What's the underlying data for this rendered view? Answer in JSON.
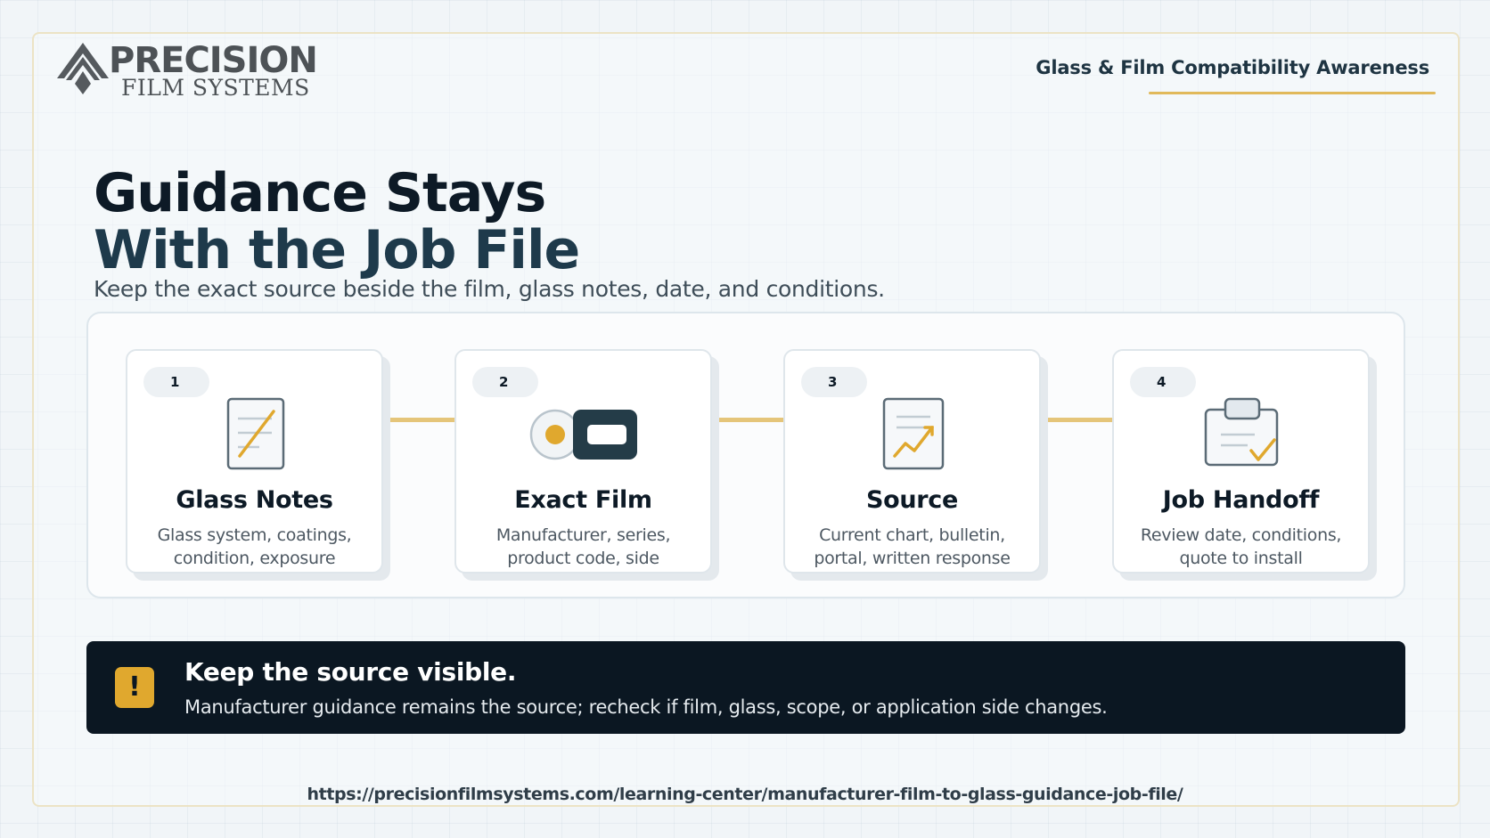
{
  "brand": {
    "logo_main": "PRECISION",
    "logo_sub": "FILM SYSTEMS"
  },
  "header": {
    "tag": "Glass & Film Compatibility Awareness"
  },
  "hero": {
    "title_line1": "Guidance Stays",
    "title_line2": "With the Job File",
    "subtitle": "Keep the exact source beside the film, glass notes, date, and conditions."
  },
  "steps": [
    {
      "number": "1",
      "icon": "document-edit-icon",
      "title": "Glass Notes",
      "desc_line1": "Glass system, coatings,",
      "desc_line2": "condition, exposure"
    },
    {
      "number": "2",
      "icon": "film-roll-icon",
      "title": "Exact Film",
      "desc_line1": "Manufacturer, series,",
      "desc_line2": "product code, side"
    },
    {
      "number": "3",
      "icon": "chart-document-icon",
      "title": "Source",
      "desc_line1": "Current chart, bulletin,",
      "desc_line2": "portal, written response"
    },
    {
      "number": "4",
      "icon": "clipboard-check-icon",
      "title": "Job Handoff",
      "desc_line1": "Review date, conditions,",
      "desc_line2": "quote to install"
    }
  ],
  "callout": {
    "icon": "exclamation-icon",
    "title": "Keep the source visible.",
    "text": "Manufacturer guidance remains the source; recheck if film, glass, scope, or application side changes."
  },
  "footer": {
    "url": "https://precisionfilmsystems.com/learning-center/manufacturer-film-to-glass-guidance-job-file/"
  },
  "colors": {
    "accent_gold": "#e0a82e",
    "dark_navy": "#0b1722",
    "title_teal": "#1e3a4b",
    "connector": "#e5c57a"
  }
}
